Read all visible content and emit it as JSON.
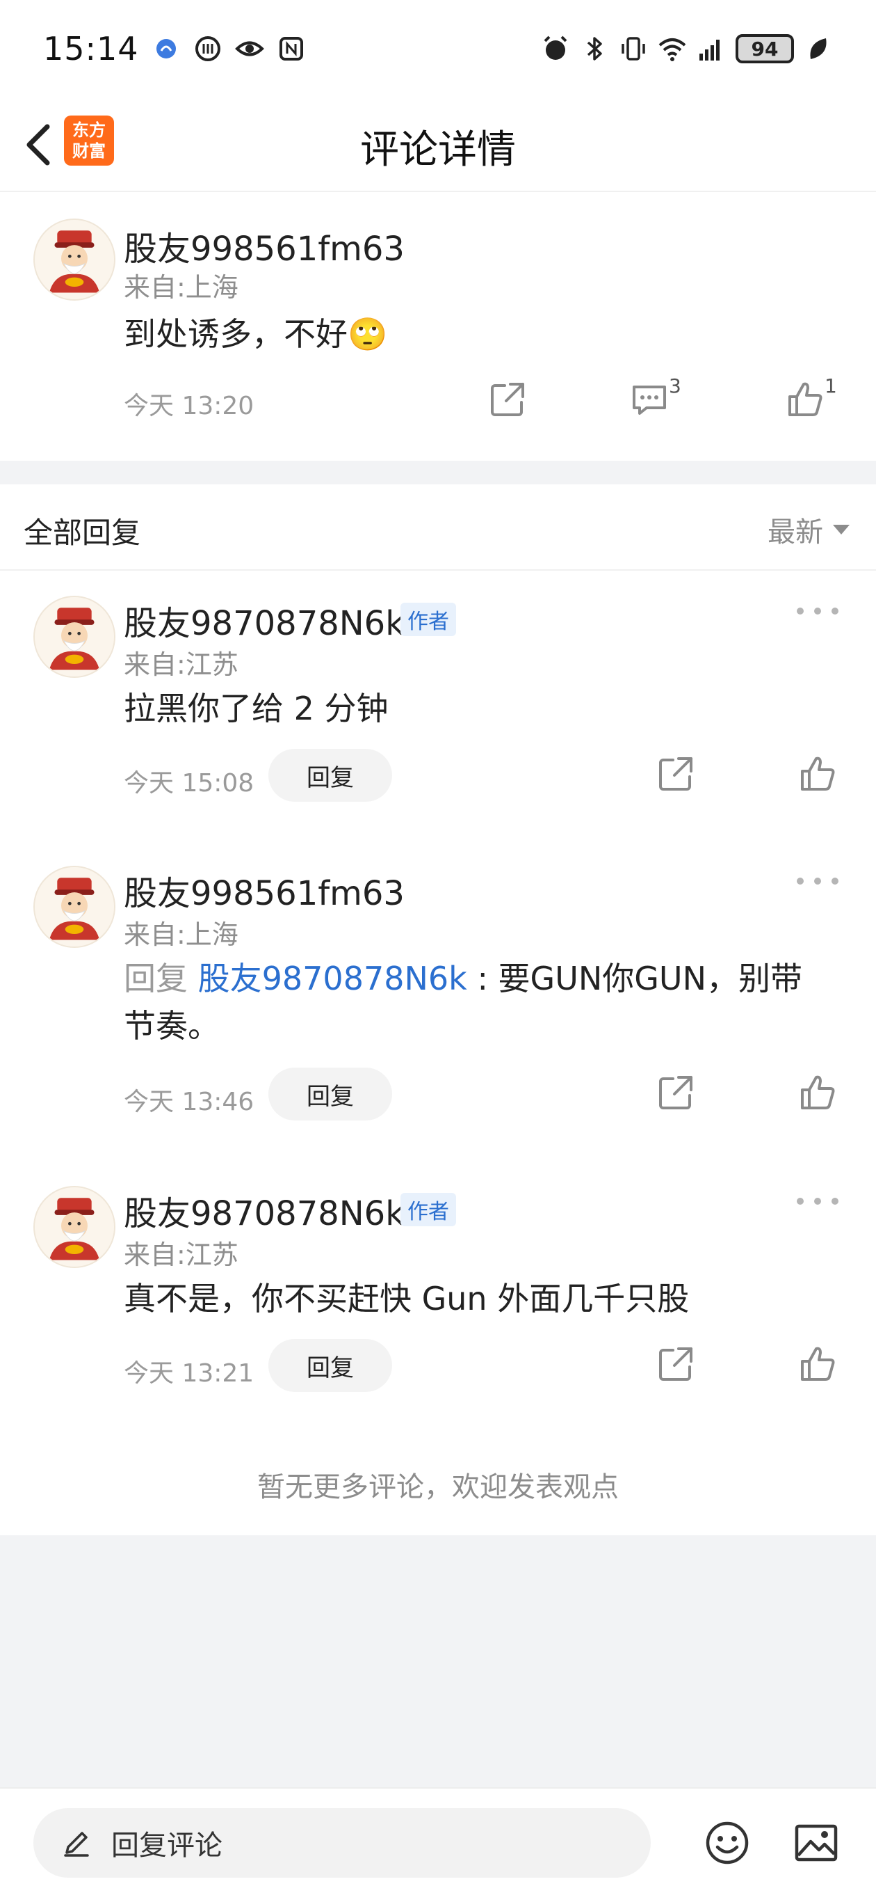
{
  "status_bar": {
    "time": "15:14",
    "battery": "94",
    "icons_left": [
      "notification-icon",
      "app-icon",
      "eye-icon",
      "nfc-icon"
    ],
    "icons_right": [
      "alarm-icon",
      "bluetooth-icon",
      "vibrate-icon",
      "wifi-icon",
      "signal-icon",
      "battery-icon",
      "leaf-icon"
    ]
  },
  "header": {
    "title": "评论详情",
    "logo_line1": "东方",
    "logo_line2": "财富",
    "brand_color": "#ff6a1a"
  },
  "main_comment": {
    "username": "股友998561fm63",
    "location": "来自:上海",
    "content": "到处诱多，不好",
    "emoji": "🙄",
    "time": "今天 13:20",
    "comment_count": "3",
    "like_count": "1"
  },
  "replies_section": {
    "label": "全部回复",
    "sort_label": "最新"
  },
  "replies": [
    {
      "username": "股友9870878N6k",
      "badge": "作者",
      "location": "来自:江苏",
      "content": "拉黑你了给 2 分钟",
      "time": "今天 15:08",
      "reply_label": "回复"
    },
    {
      "username": "股友998561fm63",
      "location": "来自:上海",
      "reply_prefix": "回复",
      "reply_target": "股友9870878N6k",
      "content_line1": ": 要GUN你GUN，别带",
      "content_line2": "节奏。",
      "time": "今天 13:46",
      "reply_label": "回复"
    },
    {
      "username": "股友9870878N6k",
      "badge": "作者",
      "location": "来自:江苏",
      "content": "真不是，你不买赶快 Gun 外面几千只股",
      "time": "今天 13:21",
      "reply_label": "回复"
    }
  ],
  "empty_tip": "暂无更多评论，欢迎发表观点",
  "bottom_bar": {
    "placeholder": "回复评论",
    "accent_link": "#2b6fcf"
  }
}
